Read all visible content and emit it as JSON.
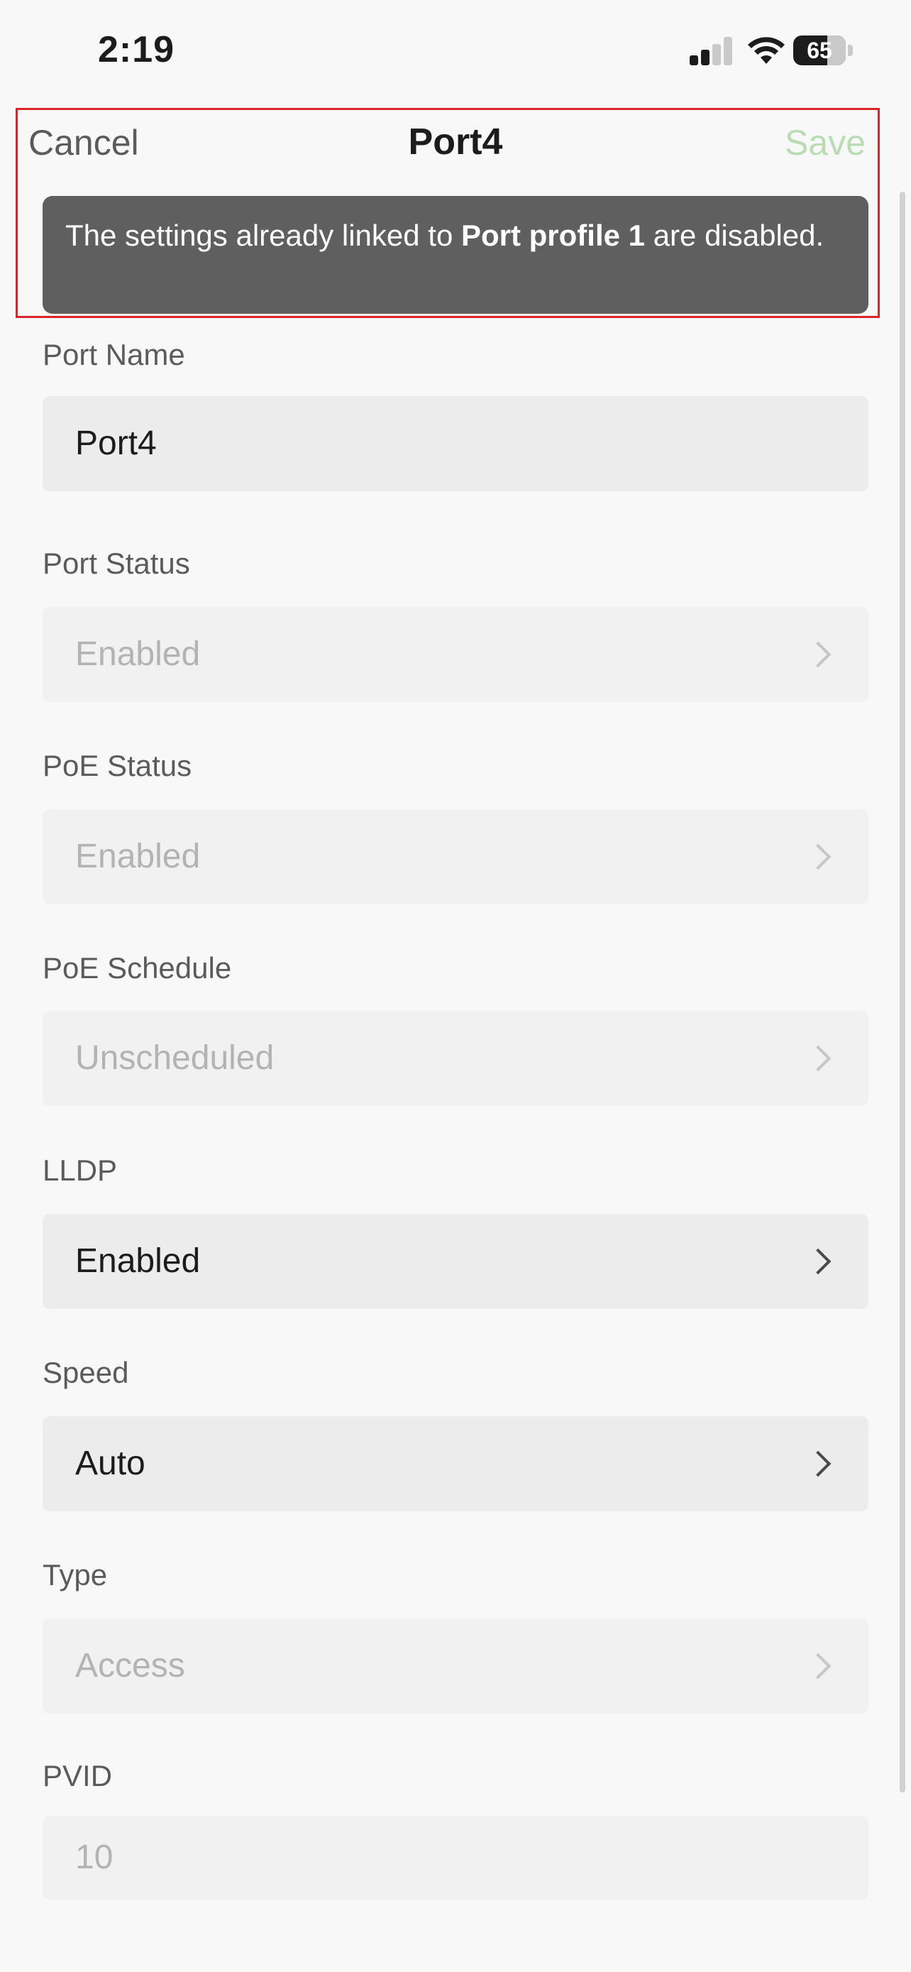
{
  "status_bar": {
    "time": "2:19",
    "battery": "65"
  },
  "nav": {
    "cancel": "Cancel",
    "title": "Port4",
    "save": "Save"
  },
  "toast": {
    "prefix": "The settings already linked to ",
    "profile": "Port profile 1",
    "suffix": " are disabled."
  },
  "form": {
    "port_name": {
      "label": "Port Name",
      "value": "Port4"
    },
    "port_status": {
      "label": "Port Status",
      "value": "Enabled"
    },
    "poe_status": {
      "label": "PoE Status",
      "value": "Enabled"
    },
    "poe_schedule": {
      "label": "PoE Schedule",
      "value": "Unscheduled"
    },
    "lldp": {
      "label": "LLDP",
      "value": "Enabled"
    },
    "speed": {
      "label": "Speed",
      "value": "Auto"
    },
    "type": {
      "label": "Type",
      "value": "Access"
    },
    "pvid": {
      "label": "PVID",
      "value": "10"
    }
  },
  "colors": {
    "save_disabled": "#b9dcb3",
    "toast_bg": "#5f5f5f",
    "highlight": "#d9262c"
  }
}
